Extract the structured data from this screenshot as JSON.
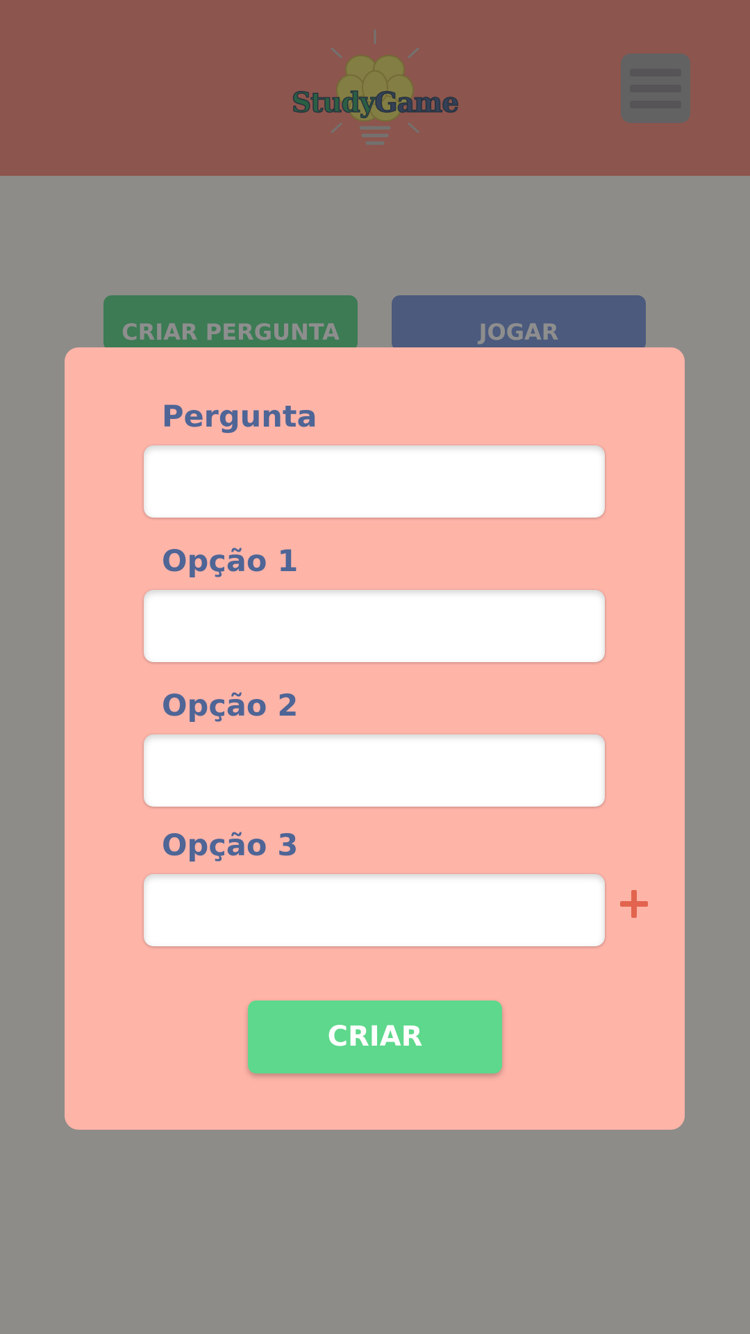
{
  "app": {
    "logo_word_1": "Study",
    "logo_word_2": "Game",
    "logo_icon": "brain-lightbulb-icon",
    "menu_icon": "hamburger-menu-icon"
  },
  "tabs": {
    "create_label": "CRIAR PERGUNTA",
    "play_label": "JOGAR"
  },
  "modal": {
    "question": {
      "label": "Pergunta",
      "value": "",
      "placeholder": ""
    },
    "options": [
      {
        "label": "Opção 1",
        "value": "",
        "placeholder": ""
      },
      {
        "label": "Opção 2",
        "value": "",
        "placeholder": ""
      },
      {
        "label": "Opção 3",
        "value": "",
        "placeholder": ""
      }
    ],
    "add_option_icon": "plus-icon",
    "submit_label": "CRIAR"
  },
  "colors": {
    "header": "#fa8c7c",
    "modal": "#ffb4a8",
    "primary_green": "#5ed88c",
    "play_blue": "#7896dc",
    "label_blue": "#4e6596",
    "accent_red": "#e2644e"
  }
}
